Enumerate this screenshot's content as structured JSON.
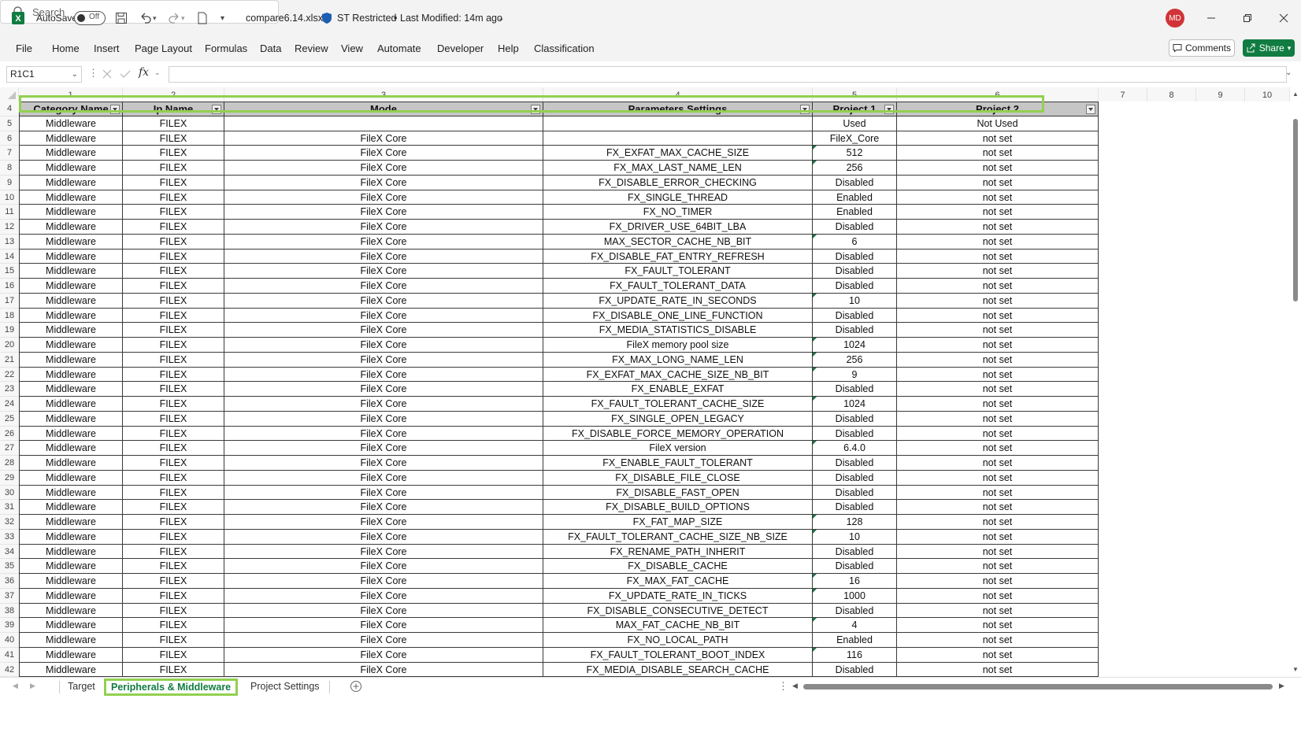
{
  "titlebar": {
    "autosave_label": "AutoSave",
    "autosave_state": "Off",
    "file_name": "compare6.14.xlsx",
    "sensitivity": "ST Restricted",
    "modified": "Last Modified: 14m ago",
    "search_placeholder": "Search",
    "user_initials": "MD",
    "accent_color": "#107c41"
  },
  "menu": [
    "File",
    "Home",
    "Insert",
    "Page Layout",
    "Formulas",
    "Data",
    "Review",
    "View",
    "Automate",
    "Developer",
    "Help",
    "Classification"
  ],
  "buttons": {
    "comments": "Comments",
    "share": "Share"
  },
  "formula": {
    "name_box": "R1C1",
    "fx": "fx",
    "value": ""
  },
  "columns": [
    "1",
    "2",
    "3",
    "4",
    "5",
    "6",
    "7",
    "8",
    "9",
    "10"
  ],
  "header_row_number": "4",
  "table": {
    "headers": [
      "Category Name",
      "Ip Name",
      "Mode",
      "Parameters Settings",
      "Project 1",
      "Project 2"
    ],
    "rows": [
      [
        "5",
        "Middleware",
        "FILEX",
        "",
        "",
        "Used",
        "Not Used"
      ],
      [
        "6",
        "Middleware",
        "FILEX",
        "FileX Core",
        "",
        "FileX_Core",
        "not set"
      ],
      [
        "7",
        "Middleware",
        "FILEX",
        "FileX Core",
        "FX_EXFAT_MAX_CACHE_SIZE",
        "512",
        "not set"
      ],
      [
        "8",
        "Middleware",
        "FILEX",
        "FileX Core",
        "FX_MAX_LAST_NAME_LEN",
        "256",
        "not set"
      ],
      [
        "9",
        "Middleware",
        "FILEX",
        "FileX Core",
        "FX_DISABLE_ERROR_CHECKING",
        "Disabled",
        "not set"
      ],
      [
        "10",
        "Middleware",
        "FILEX",
        "FileX Core",
        "FX_SINGLE_THREAD",
        "Enabled",
        "not set"
      ],
      [
        "11",
        "Middleware",
        "FILEX",
        "FileX Core",
        "FX_NO_TIMER",
        "Enabled",
        "not set"
      ],
      [
        "12",
        "Middleware",
        "FILEX",
        "FileX Core",
        "FX_DRIVER_USE_64BIT_LBA",
        "Disabled",
        "not set"
      ],
      [
        "13",
        "Middleware",
        "FILEX",
        "FileX Core",
        "MAX_SECTOR_CACHE_NB_BIT",
        "6",
        "not set"
      ],
      [
        "14",
        "Middleware",
        "FILEX",
        "FileX Core",
        "FX_DISABLE_FAT_ENTRY_REFRESH",
        "Disabled",
        "not set"
      ],
      [
        "15",
        "Middleware",
        "FILEX",
        "FileX Core",
        "FX_FAULT_TOLERANT",
        "Disabled",
        "not set"
      ],
      [
        "16",
        "Middleware",
        "FILEX",
        "FileX Core",
        "FX_FAULT_TOLERANT_DATA",
        "Disabled",
        "not set"
      ],
      [
        "17",
        "Middleware",
        "FILEX",
        "FileX Core",
        "FX_UPDATE_RATE_IN_SECONDS",
        "10",
        "not set"
      ],
      [
        "18",
        "Middleware",
        "FILEX",
        "FileX Core",
        "FX_DISABLE_ONE_LINE_FUNCTION",
        "Disabled",
        "not set"
      ],
      [
        "19",
        "Middleware",
        "FILEX",
        "FileX Core",
        "FX_MEDIA_STATISTICS_DISABLE",
        "Disabled",
        "not set"
      ],
      [
        "20",
        "Middleware",
        "FILEX",
        "FileX Core",
        "FileX memory pool size",
        "1024",
        "not set"
      ],
      [
        "21",
        "Middleware",
        "FILEX",
        "FileX Core",
        "FX_MAX_LONG_NAME_LEN",
        "256",
        "not set"
      ],
      [
        "22",
        "Middleware",
        "FILEX",
        "FileX Core",
        "FX_EXFAT_MAX_CACHE_SIZE_NB_BIT",
        "9",
        "not set"
      ],
      [
        "23",
        "Middleware",
        "FILEX",
        "FileX Core",
        "FX_ENABLE_EXFAT",
        "Disabled",
        "not set"
      ],
      [
        "24",
        "Middleware",
        "FILEX",
        "FileX Core",
        "FX_FAULT_TOLERANT_CACHE_SIZE",
        "1024",
        "not set"
      ],
      [
        "25",
        "Middleware",
        "FILEX",
        "FileX Core",
        "FX_SINGLE_OPEN_LEGACY",
        "Disabled",
        "not set"
      ],
      [
        "26",
        "Middleware",
        "FILEX",
        "FileX Core",
        "FX_DISABLE_FORCE_MEMORY_OPERATION",
        "Disabled",
        "not set"
      ],
      [
        "27",
        "Middleware",
        "FILEX",
        "FileX Core",
        "FileX version",
        "6.4.0",
        "not set"
      ],
      [
        "28",
        "Middleware",
        "FILEX",
        "FileX Core",
        "FX_ENABLE_FAULT_TOLERANT",
        "Disabled",
        "not set"
      ],
      [
        "29",
        "Middleware",
        "FILEX",
        "FileX Core",
        "FX_DISABLE_FILE_CLOSE",
        "Disabled",
        "not set"
      ],
      [
        "30",
        "Middleware",
        "FILEX",
        "FileX Core",
        "FX_DISABLE_FAST_OPEN",
        "Disabled",
        "not set"
      ],
      [
        "31",
        "Middleware",
        "FILEX",
        "FileX Core",
        "FX_DISABLE_BUILD_OPTIONS",
        "Disabled",
        "not set"
      ],
      [
        "32",
        "Middleware",
        "FILEX",
        "FileX Core",
        "FX_FAT_MAP_SIZE",
        "128",
        "not set"
      ],
      [
        "33",
        "Middleware",
        "FILEX",
        "FileX Core",
        "FX_FAULT_TOLERANT_CACHE_SIZE_NB_SIZE",
        "10",
        "not set"
      ],
      [
        "34",
        "Middleware",
        "FILEX",
        "FileX Core",
        "FX_RENAME_PATH_INHERIT",
        "Disabled",
        "not set"
      ],
      [
        "35",
        "Middleware",
        "FILEX",
        "FileX Core",
        "FX_DISABLE_CACHE",
        "Disabled",
        "not set"
      ],
      [
        "36",
        "Middleware",
        "FILEX",
        "FileX Core",
        "FX_MAX_FAT_CACHE",
        "16",
        "not set"
      ],
      [
        "37",
        "Middleware",
        "FILEX",
        "FileX Core",
        "FX_UPDATE_RATE_IN_TICKS",
        "1000",
        "not set"
      ],
      [
        "38",
        "Middleware",
        "FILEX",
        "FileX Core",
        "FX_DISABLE_CONSECUTIVE_DETECT",
        "Disabled",
        "not set"
      ],
      [
        "39",
        "Middleware",
        "FILEX",
        "FileX Core",
        "MAX_FAT_CACHE_NB_BIT",
        "4",
        "not set"
      ],
      [
        "40",
        "Middleware",
        "FILEX",
        "FileX Core",
        "FX_NO_LOCAL_PATH",
        "Enabled",
        "not set"
      ],
      [
        "41",
        "Middleware",
        "FILEX",
        "FileX Core",
        "FX_FAULT_TOLERANT_BOOT_INDEX",
        "116",
        "not set"
      ],
      [
        "42",
        "Middleware",
        "FILEX",
        "FileX Core",
        "FX_MEDIA_DISABLE_SEARCH_CACHE",
        "Disabled",
        "not set"
      ]
    ]
  },
  "sheets": [
    "Target",
    "Peripherals & Middleware",
    "Project Settings"
  ],
  "active_sheet": "Peripherals & Middleware"
}
